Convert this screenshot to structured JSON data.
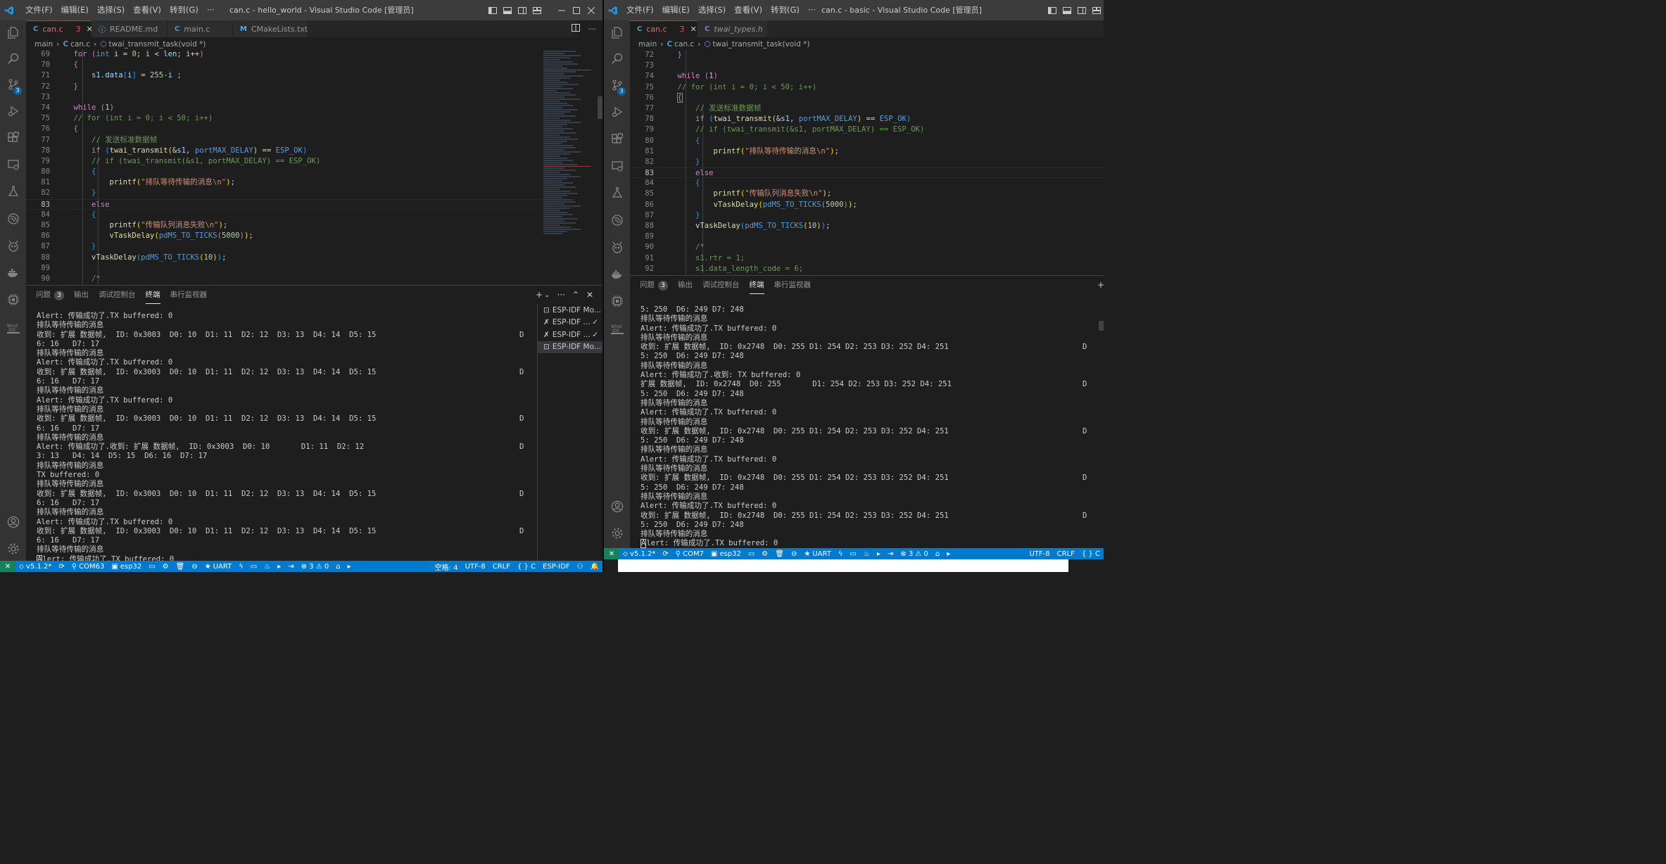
{
  "left": {
    "window_title": "can.c - hello_world - Visual Studio Code [管理员]",
    "menus": [
      "文件(F)",
      "编辑(E)",
      "选择(S)",
      "查看(V)",
      "转到(G)",
      "···"
    ],
    "tabs": [
      {
        "icon": "C",
        "label": "can.c",
        "badge": "3",
        "close": "✕"
      },
      {
        "icon": "ⓘ",
        "label": "README.md"
      },
      {
        "icon": "C",
        "label": "main.c"
      },
      {
        "icon": "M",
        "label": "CMakeLists.txt"
      }
    ],
    "breadcrumb": [
      "main",
      "can.c",
      "twai_transmit_task(void *)"
    ],
    "source_control_badge": "3",
    "code_lines": [
      {
        "n": "69"
      },
      {
        "n": "70"
      },
      {
        "n": "71"
      },
      {
        "n": "72"
      },
      {
        "n": "73"
      },
      {
        "n": "74"
      },
      {
        "n": "75"
      },
      {
        "n": "76"
      },
      {
        "n": "77"
      },
      {
        "n": "78"
      },
      {
        "n": "79"
      },
      {
        "n": "80"
      },
      {
        "n": "81"
      },
      {
        "n": "82"
      },
      {
        "n": "83"
      },
      {
        "n": "84"
      },
      {
        "n": "85"
      },
      {
        "n": "86"
      },
      {
        "n": "87"
      },
      {
        "n": "88"
      },
      {
        "n": "89"
      },
      {
        "n": "90"
      }
    ],
    "code": {
      "for_kw": "for",
      "int_kw": "int",
      "i": "i",
      "len": "len",
      "s1": "s1",
      "data": "data",
      "n0": "0",
      "n255": "255",
      "n1": "1",
      "n50": "50",
      "n5000": "5000",
      "n10": "10",
      "while_kw": "while",
      "if_kw": "if",
      "else_kw": "else",
      "c_for": "// for (int i = 0; i < 50; i++)",
      "c_send": "// 发送标准数据帧",
      "c_if": "// if (twai_transmit(&s1, portMAX_DELAY) == ESP_OK)",
      "c_open": "/*",
      "twai": "twai_transmit",
      "portmax": "portMAX_DELAY",
      "espok": "ESP_OK",
      "printf": "printf",
      "vtd": "vTaskDelay",
      "pdms": "pdMS_TO_TICKS",
      "s_wait": "\"排队等待传输的消息\\n\"",
      "s_fail": "\"传输队列消息失败\\n\""
    },
    "panel_tabs": [
      {
        "label": "问题",
        "badge": "3"
      },
      {
        "label": "输出"
      },
      {
        "label": "调试控制台"
      },
      {
        "label": "终端"
      },
      {
        "label": "串行监视器"
      }
    ],
    "panel_actions": [
      "+",
      "⌄",
      "···",
      "⌃",
      "✕"
    ],
    "terminals": [
      {
        "label": "ESP-IDF Mo..."
      },
      {
        "label": "ESP-IDF ...",
        "check": "✓"
      },
      {
        "label": "ESP-IDF ...",
        "check": "✓"
      },
      {
        "label": "ESP-IDF Mo..."
      }
    ],
    "terminal_lines": [
      {
        "t": "Alert: 传输成功了.TX buffered: 0",
        "r": ""
      },
      {
        "t": "排队等待传输的消息",
        "r": ""
      },
      {
        "t": "收到: 扩展 数据帧,  ID: 0x3003  D0: 10  D1: 11  D2: 12  D3: 13  D4: 14  D5: 15",
        "r": "D"
      },
      {
        "t": "6: 16   D7: 17",
        "r": ""
      },
      {
        "t": "排队等待传输的消息",
        "r": ""
      },
      {
        "t": "Alert: 传输成功了.TX buffered: 0",
        "r": ""
      },
      {
        "t": "收到: 扩展 数据帧,  ID: 0x3003  D0: 10  D1: 11  D2: 12  D3: 13  D4: 14  D5: 15",
        "r": "D"
      },
      {
        "t": "6: 16   D7: 17",
        "r": ""
      },
      {
        "t": "排队等待传输的消息",
        "r": ""
      },
      {
        "t": "Alert: 传输成功了.TX buffered: 0",
        "r": ""
      },
      {
        "t": "排队等待传输的消息",
        "r": ""
      },
      {
        "t": "收到: 扩展 数据帧,  ID: 0x3003  D0: 10  D1: 11  D2: 12  D3: 13  D4: 14  D5: 15",
        "r": "D"
      },
      {
        "t": "6: 16   D7: 17",
        "r": ""
      },
      {
        "t": "排队等待传输的消息",
        "r": ""
      },
      {
        "t": "Alert: 传输成功了.收到: 扩展 数据帧,  ID: 0x3003  D0: 10       D1: 11  D2: 12",
        "r": "D"
      },
      {
        "t": "3: 13   D4: 14  D5: 15  D6: 16  D7: 17",
        "r": ""
      },
      {
        "t": "排队等待传输的消息",
        "r": ""
      },
      {
        "t": "TX buffered: 0",
        "r": ""
      },
      {
        "t": "排队等待传输的消息",
        "r": ""
      },
      {
        "t": "收到: 扩展 数据帧,  ID: 0x3003  D0: 10  D1: 11  D2: 12  D3: 13  D4: 14  D5: 15",
        "r": "D"
      },
      {
        "t": "6: 16   D7: 17",
        "r": ""
      },
      {
        "t": "排队等待传输的消息",
        "r": ""
      },
      {
        "t": "Alert: 传输成功了.TX buffered: 0",
        "r": ""
      },
      {
        "t": "收到: 扩展 数据帧,  ID: 0x3003  D0: 10  D1: 11  D2: 12  D3: 13  D4: 14  D5: 15",
        "r": "D"
      },
      {
        "t": "6: 16   D7: 17",
        "r": ""
      },
      {
        "t": "排队等待传输的消息",
        "r": ""
      }
    ],
    "terminal_last": "lert: 传输成功了.TX buffered: 0",
    "terminal_last_cursor": "A",
    "status": {
      "remote": "✕",
      "items": [
        "v5.1.2*",
        "COM63",
        "esp32",
        "UART",
        "⊗ 3 ⚠ 0"
      ],
      "right": [
        "空格: 4",
        "UTF-8",
        "CRLF",
        "{ } C",
        "ESP-IDF"
      ]
    }
  },
  "right": {
    "window_title": "can.c - basic - Visual Studio Code [管理员]",
    "menus": [
      "文件(F)",
      "编辑(E)",
      "选择(S)",
      "查看(V)",
      "转到(G)",
      "···"
    ],
    "tabs": [
      {
        "icon": "C",
        "label": "can.c",
        "badge": "3",
        "close": "✕"
      },
      {
        "icon": "C",
        "label": "twai_types.h"
      }
    ],
    "breadcrumb": [
      "main",
      "can.c",
      "twai_transmit_task(void *)"
    ],
    "source_control_badge": "3",
    "code_lines": [
      {
        "n": "72"
      },
      {
        "n": "73"
      },
      {
        "n": "74"
      },
      {
        "n": "75"
      },
      {
        "n": "76"
      },
      {
        "n": "77"
      },
      {
        "n": "78"
      },
      {
        "n": "79"
      },
      {
        "n": "80"
      },
      {
        "n": "81"
      },
      {
        "n": "82"
      },
      {
        "n": "83"
      },
      {
        "n": "84"
      },
      {
        "n": "85"
      },
      {
        "n": "86"
      },
      {
        "n": "87"
      },
      {
        "n": "88"
      },
      {
        "n": "89"
      },
      {
        "n": "90"
      },
      {
        "n": "91"
      },
      {
        "n": "92"
      }
    ],
    "code": {
      "while_kw": "while",
      "if_kw": "if",
      "else_kw": "else",
      "n1": "1",
      "n5000": "5000",
      "n10": "10",
      "n6": "6",
      "c_for": "// for (int i = 0; i < 50; i++)",
      "c_send": "// 发送标准数据帧",
      "c_if": "// if (twai_transmit(&s1, portMAX_DELAY) == ESP_OK)",
      "c_open": "/*",
      "c_rtr": "s1.rtr = 1;",
      "c_dlc": "s1.data_length_code = 6;",
      "twai": "twai_transmit",
      "s1": "s1",
      "portmax": "portMAX_DELAY",
      "espok": "ESP_OK",
      "printf": "printf",
      "vtd": "vTaskDelay",
      "pdms": "pdMS_TO_TICKS",
      "s_wait": "\"排队等待传输的消息\\n\"",
      "s_fail": "\"传输队列消息失败\\n\""
    },
    "panel_tabs": [
      {
        "label": "问题",
        "badge": "3"
      },
      {
        "label": "输出"
      },
      {
        "label": "调试控制台"
      },
      {
        "label": "终端"
      },
      {
        "label": "串行监视器"
      }
    ],
    "panel_actions": [
      "+"
    ],
    "terminal_lines": [
      {
        "t": "5: 250  D6: 249 D7: 248",
        "r": ""
      },
      {
        "t": "排队等待传输的消息",
        "r": ""
      },
      {
        "t": "Alert: 传输成功了.TX buffered: 0",
        "r": ""
      },
      {
        "t": "排队等待传输的消息",
        "r": ""
      },
      {
        "t": "收到: 扩展 数据帧,  ID: 0x2748  D0: 255 D1: 254 D2: 253 D3: 252 D4: 251",
        "r": "D"
      },
      {
        "t": "5: 250  D6: 249 D7: 248",
        "r": ""
      },
      {
        "t": "排队等待传输的消息",
        "r": ""
      },
      {
        "t": "Alert: 传输成功了.收到: TX buffered: 0",
        "r": ""
      },
      {
        "t": "扩展 数据帧,  ID: 0x2748  D0: 255       D1: 254 D2: 253 D3: 252 D4: 251",
        "r": "D"
      },
      {
        "t": "5: 250  D6: 249 D7: 248",
        "r": ""
      },
      {
        "t": "排队等待传输的消息",
        "r": ""
      },
      {
        "t": "Alert: 传输成功了.TX buffered: 0",
        "r": ""
      },
      {
        "t": "排队等待传输的消息",
        "r": ""
      },
      {
        "t": "收到: 扩展 数据帧,  ID: 0x2748  D0: 255 D1: 254 D2: 253 D3: 252 D4: 251",
        "r": "D"
      },
      {
        "t": "5: 250  D6: 249 D7: 248",
        "r": ""
      },
      {
        "t": "排队等待传输的消息",
        "r": ""
      },
      {
        "t": "Alert: 传输成功了.TX buffered: 0",
        "r": ""
      },
      {
        "t": "排队等待传输的消息",
        "r": ""
      },
      {
        "t": "收到: 扩展 数据帧,  ID: 0x2748  D0: 255 D1: 254 D2: 253 D3: 252 D4: 251",
        "r": "D"
      },
      {
        "t": "5: 250  D6: 249 D7: 248",
        "r": ""
      },
      {
        "t": "排队等待传输的消息",
        "r": ""
      },
      {
        "t": "Alert: 传输成功了.TX buffered: 0",
        "r": ""
      },
      {
        "t": "收到: 扩展 数据帧,  ID: 0x2748  D0: 255 D1: 254 D2: 253 D3: 252 D4: 251",
        "r": "D"
      },
      {
        "t": "5: 250  D6: 249 D7: 248",
        "r": ""
      },
      {
        "t": "排队等待传输的消息",
        "r": ""
      }
    ],
    "terminal_last": "lert: 传输成功了.TX buffered: 0",
    "terminal_last_cursor": "A",
    "status": {
      "remote": "✕",
      "items": [
        "v5.1.2*",
        "COM7",
        "esp32",
        "UART",
        "⊗ 3 ⚠ 0"
      ],
      "right": [
        "UTF-8",
        "CRLF",
        "{ } C"
      ]
    }
  }
}
